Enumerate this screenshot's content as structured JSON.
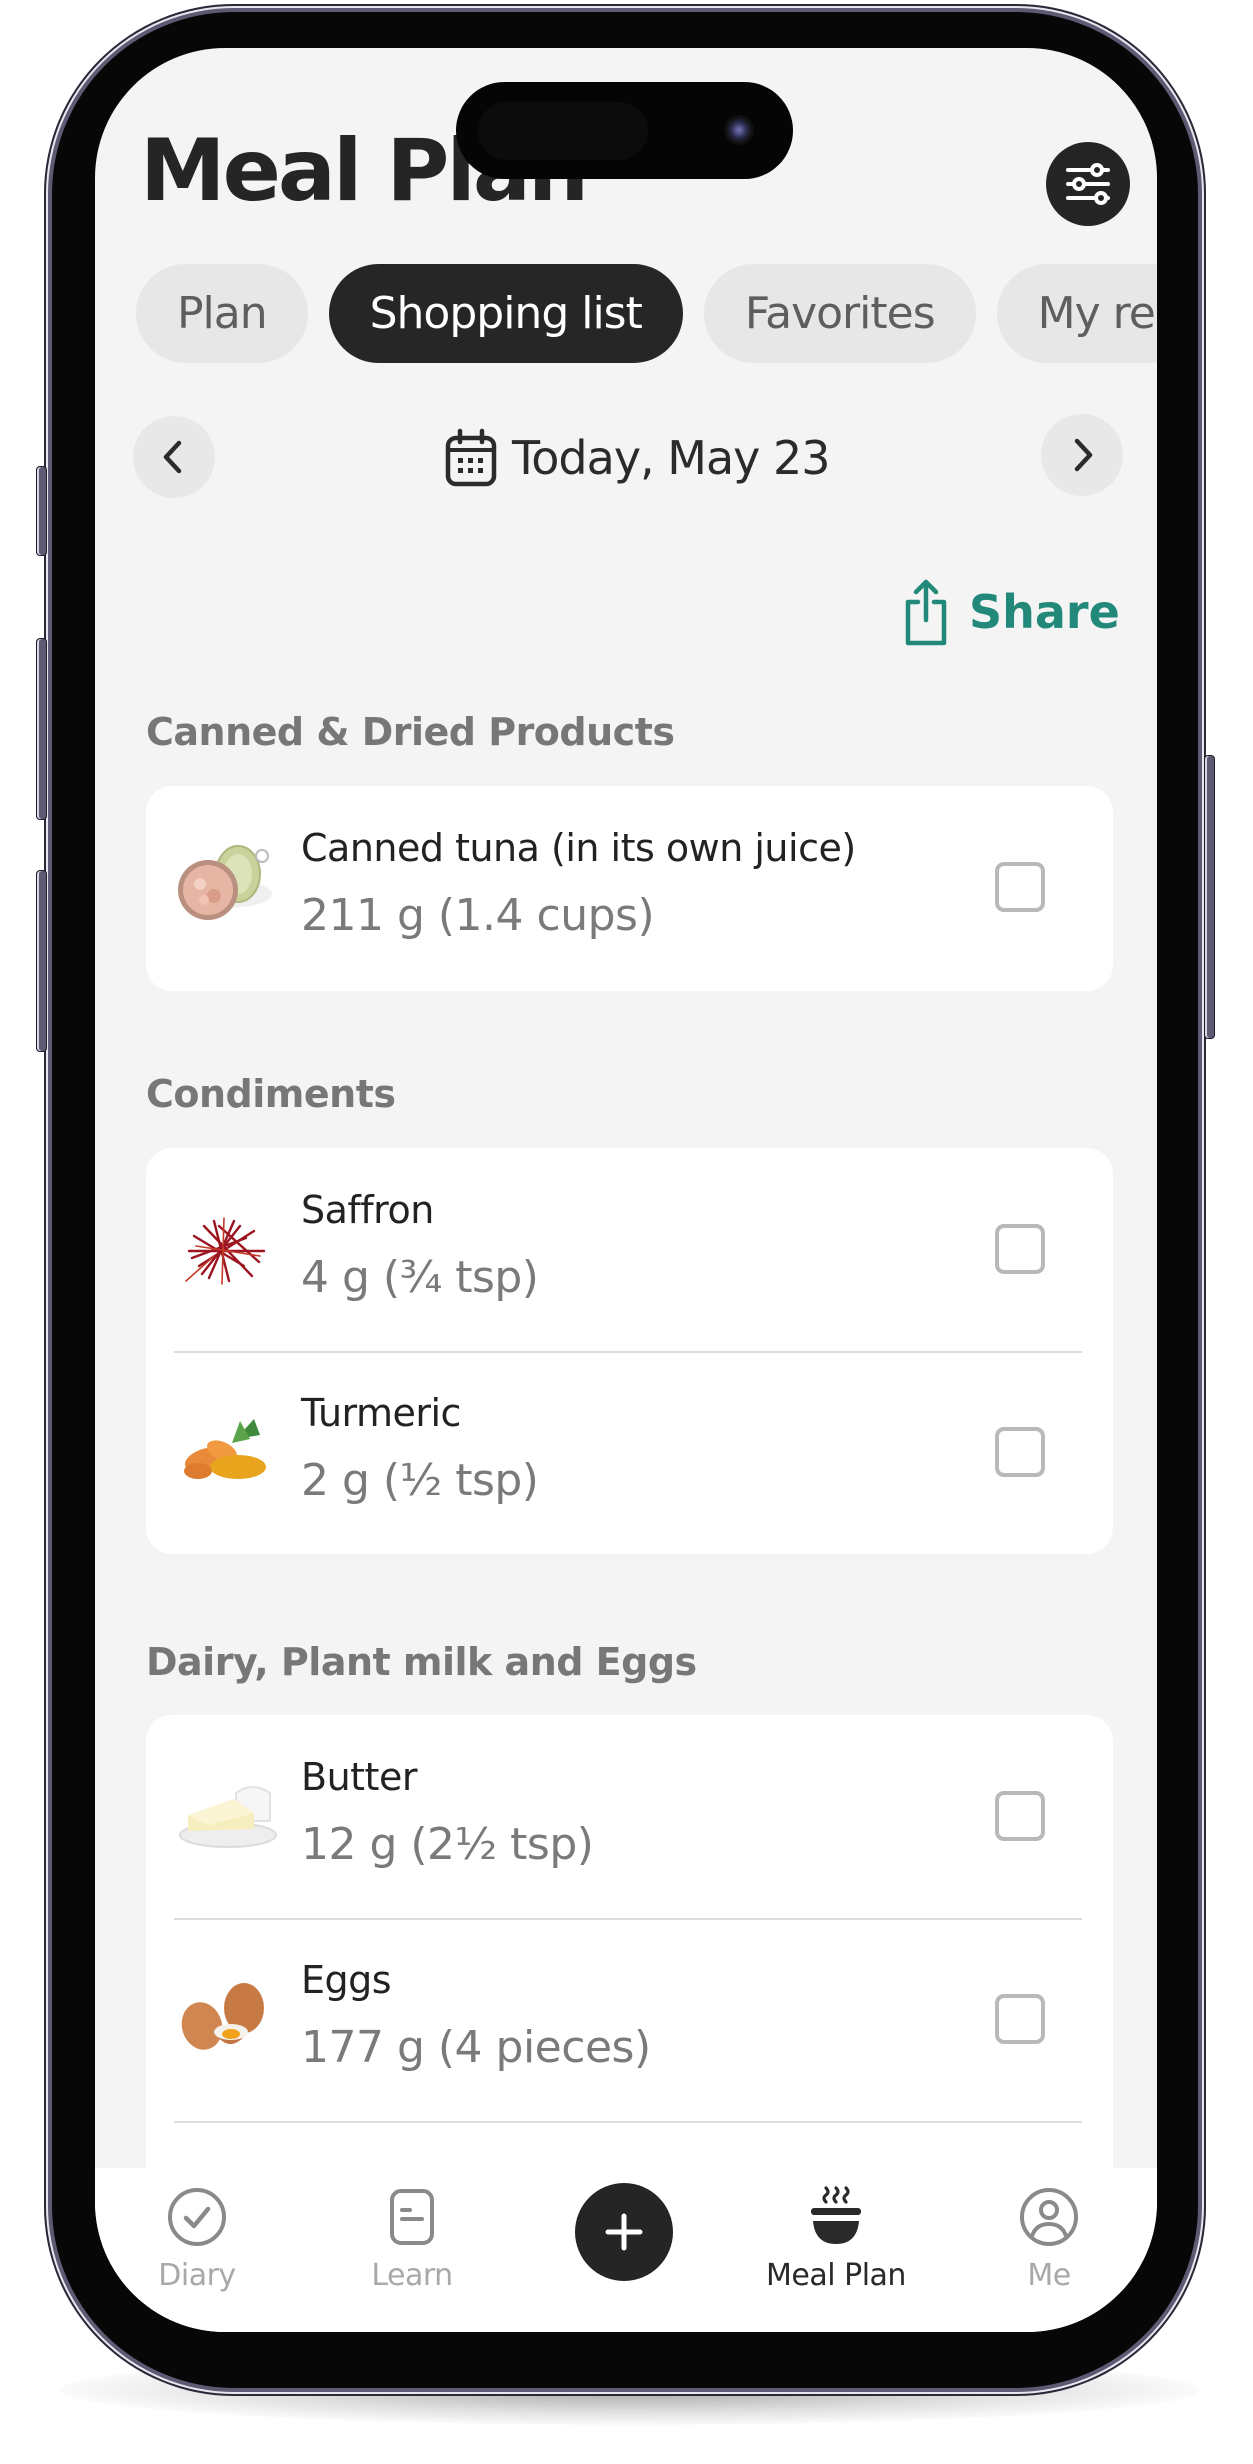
{
  "header": {
    "title": "Meal Plan",
    "filter_icon": "sliders-icon"
  },
  "tabs": [
    {
      "label": "Plan",
      "active": false
    },
    {
      "label": "Shopping list",
      "active": true
    },
    {
      "label": "Favorites",
      "active": false
    },
    {
      "label": "My recipes",
      "visible_label": "My re",
      "active": false
    }
  ],
  "date_nav": {
    "prev_icon": "chevron-left-icon",
    "next_icon": "chevron-right-icon",
    "calendar_icon": "calendar-icon",
    "label": "Today, May 23"
  },
  "share": {
    "label": "Share",
    "icon": "share-icon",
    "color": "#22897a"
  },
  "sections": [
    {
      "label": "Canned & Dried Products",
      "items": [
        {
          "name": "Canned tuna (in its own juice)",
          "amount": "211 g (1.4 cups)",
          "image": "canned-tuna-image",
          "checked": false
        }
      ]
    },
    {
      "label": "Condiments",
      "items": [
        {
          "name": "Saffron",
          "amount": "4 g (¾ tsp)",
          "image": "saffron-image",
          "checked": false
        },
        {
          "name": "Turmeric",
          "amount": "2 g (½ tsp)",
          "image": "turmeric-image",
          "checked": false
        }
      ]
    },
    {
      "label": "Dairy, Plant milk and Eggs",
      "items": [
        {
          "name": "Butter",
          "amount": "12 g (2½ tsp)",
          "image": "butter-image",
          "checked": false
        },
        {
          "name": "Eggs",
          "amount": "177 g (4 pieces)",
          "image": "eggs-image",
          "checked": false
        }
      ]
    }
  ],
  "bottom_nav": [
    {
      "label": "Diary",
      "icon": "check-circle-icon",
      "active": false
    },
    {
      "label": "Learn",
      "icon": "note-icon",
      "active": false
    },
    {
      "label": "",
      "icon": "plus-icon",
      "active": false
    },
    {
      "label": "Meal Plan",
      "icon": "steaming-bowl-icon",
      "active": true
    },
    {
      "label": "Me",
      "icon": "user-circle-icon",
      "active": false
    }
  ]
}
